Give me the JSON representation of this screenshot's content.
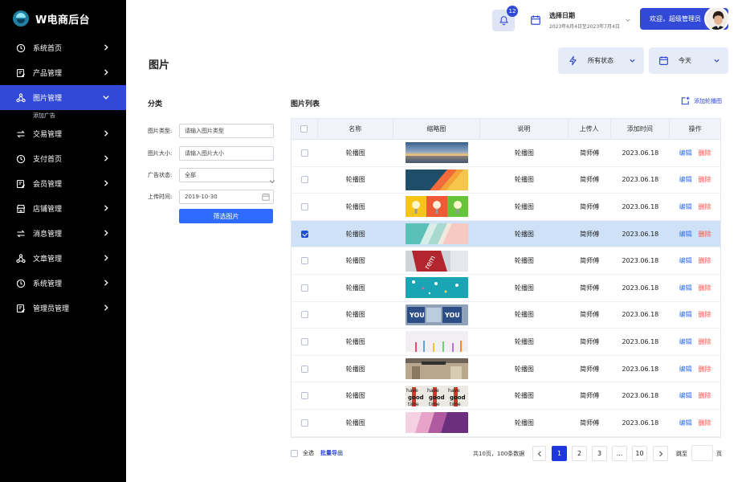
{
  "sidebar": {
    "brand": "W电商后台",
    "items": [
      {
        "label": "系统首页",
        "icon": "clock-icon"
      },
      {
        "label": "产品管理",
        "icon": "edit-icon"
      },
      {
        "label": "图片管理",
        "icon": "network-icon",
        "active": true,
        "sub": [
          "添加广告"
        ]
      },
      {
        "label": "交易管理",
        "icon": "transfer-icon"
      },
      {
        "label": "支付首页",
        "icon": "clock-icon"
      },
      {
        "label": "会员管理",
        "icon": "edit-icon"
      },
      {
        "label": "店铺管理",
        "icon": "store-icon"
      },
      {
        "label": "消息管理",
        "icon": "transfer-icon"
      },
      {
        "label": "文章管理",
        "icon": "network-icon"
      },
      {
        "label": "系统管理",
        "icon": "clock-icon"
      },
      {
        "label": "管理员管理",
        "icon": "edit-icon"
      }
    ]
  },
  "topbar": {
    "notification_count": "12",
    "date_title": "选择日期",
    "date_range": "2023年6月4日至2023年7月4日",
    "welcome": "欢迎，超级管理员"
  },
  "page": {
    "title": "图片",
    "status_filter": "所有状态",
    "day_filter": "今天"
  },
  "category": {
    "title": "分类",
    "fields": [
      {
        "label": "图片类型:",
        "value": "请输入图片类型"
      },
      {
        "label": "图片大小:",
        "value": "请输入图片大小"
      },
      {
        "label": "广告状态:",
        "value": "全部"
      },
      {
        "label": "上传时间:",
        "value": "2019-10-30"
      }
    ],
    "submit": "筛选图片"
  },
  "list": {
    "title": "图片列表",
    "add_label": "添加轮播图",
    "columns": [
      "名称",
      "缩略图",
      "说明",
      "上传人",
      "添加时间",
      "操作"
    ],
    "edit_label": "编辑",
    "delete_label": "删除",
    "rows": [
      {
        "name": "轮播图",
        "desc": "轮播图",
        "uploader": "简师傅",
        "time": "2023.06.18",
        "thumb": "sky",
        "selected": false
      },
      {
        "name": "轮播图",
        "desc": "轮播图",
        "uploader": "简师傅",
        "time": "2023.06.18",
        "thumb": "stripes",
        "selected": false
      },
      {
        "name": "轮播图",
        "desc": "轮播图",
        "uploader": "简师傅",
        "time": "2023.06.18",
        "thumb": "bulbs",
        "selected": false
      },
      {
        "name": "轮播图",
        "desc": "轮播图",
        "uploader": "简师傅",
        "time": "2023.06.18",
        "thumb": "pastel",
        "selected": true
      },
      {
        "name": "轮播图",
        "desc": "轮播图",
        "uploader": "简师傅",
        "time": "2023.06.18",
        "thumb": "sign",
        "selected": false
      },
      {
        "name": "轮播图",
        "desc": "轮播图",
        "uploader": "简师傅",
        "time": "2023.06.18",
        "thumb": "teal",
        "selected": false
      },
      {
        "name": "轮播图",
        "desc": "轮播图",
        "uploader": "简师傅",
        "time": "2023.06.18",
        "thumb": "youbanner",
        "selected": false
      },
      {
        "name": "轮播图",
        "desc": "轮播图",
        "uploader": "简师傅",
        "time": "2023.06.18",
        "thumb": "pencils",
        "selected": false
      },
      {
        "name": "轮播图",
        "desc": "轮播图",
        "uploader": "简师傅",
        "time": "2023.06.18",
        "thumb": "street",
        "selected": false
      },
      {
        "name": "轮播图",
        "desc": "轮播图",
        "uploader": "简师傅",
        "time": "2023.06.18",
        "thumb": "goodtime",
        "selected": false
      },
      {
        "name": "轮播图",
        "desc": "轮播图",
        "uploader": "简师傅",
        "time": "2023.06.18",
        "thumb": "pinkstripes",
        "selected": false
      }
    ]
  },
  "footer": {
    "select_all": "全选",
    "bulk_export": "批量导出",
    "page_info": "共10页，100条数据",
    "pages": [
      "1",
      "2",
      "3",
      "…",
      "10"
    ],
    "current_page": "1",
    "jump_label": "跳至",
    "jump_unit": "页"
  }
}
